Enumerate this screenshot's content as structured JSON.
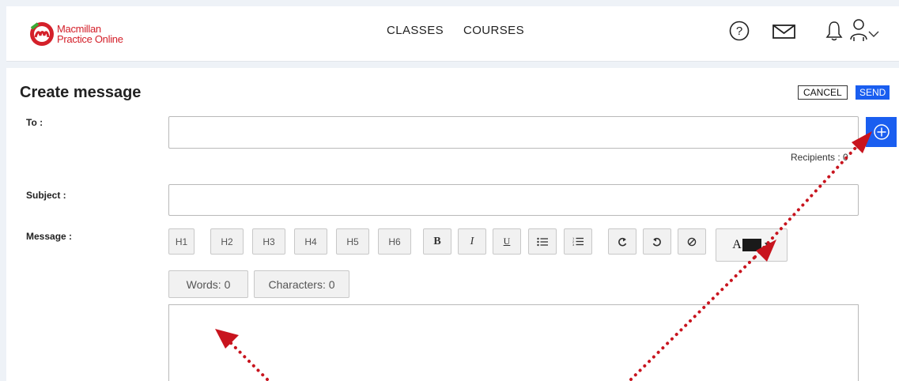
{
  "header": {
    "logo_line1": "Macmillan",
    "logo_line2": "Practice Online",
    "nav": [
      "CLASSES",
      "COURSES"
    ],
    "icons": [
      "help-icon",
      "mail-icon",
      "bell-icon",
      "user-icon",
      "chevron-down-icon"
    ]
  },
  "page": {
    "title": "Create message",
    "cancel_label": "CANCEL",
    "send_label": "SEND"
  },
  "form": {
    "to_label": "To :",
    "to_value": "",
    "recipients_text": "Recipients : 0",
    "subject_label": "Subject :",
    "subject_value": "",
    "message_label": "Message :",
    "message_value": ""
  },
  "toolbar": {
    "headings": [
      "H1",
      "H2",
      "H3",
      "H4",
      "H5",
      "H6"
    ],
    "format": [
      "B",
      "I",
      "U"
    ],
    "words_label": "Words: 0",
    "characters_label": "Characters: 0",
    "font_color_letter": "A",
    "font_color": "#1a1a1a"
  },
  "colors": {
    "accent": "#1a5ef0",
    "logo_red": "#d4202a",
    "arrow_red": "#c8141e"
  }
}
